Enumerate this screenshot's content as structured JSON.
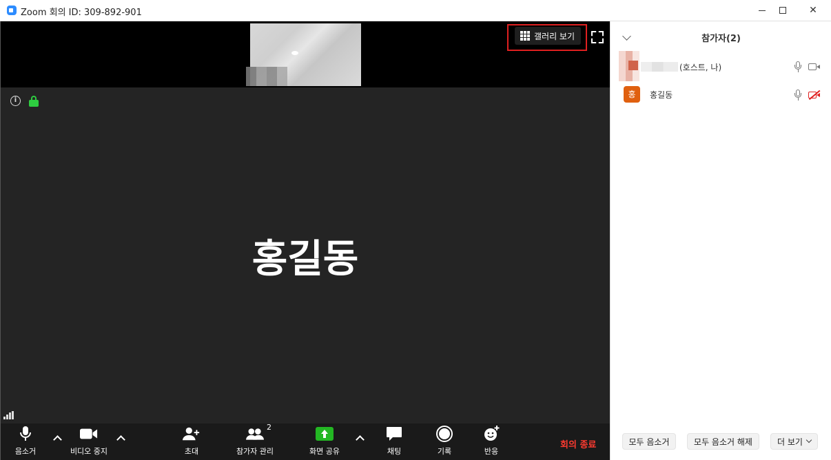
{
  "window": {
    "title": "Zoom 회의 ID: 309-892-901",
    "app_icon": "zoom-camera-icon"
  },
  "video": {
    "gallery_label": "갤러리 보기",
    "speaker_name": "홍길동"
  },
  "toolbar": {
    "mute_label": "음소거",
    "stop_video_label": "비디오 중지",
    "invite_label": "초대",
    "participants_label": "참가자 관리",
    "participants_count": "2",
    "share_label": "화면 공유",
    "chat_label": "채팅",
    "record_label": "기록",
    "reactions_label": "반응",
    "end_label": "회의 종료",
    "share_color": "#23b723",
    "end_color": "#ff3b30"
  },
  "panel": {
    "title": "참가자(2)",
    "participants": [
      {
        "name": "(호스트, 나)",
        "mic": "on",
        "video": "on"
      },
      {
        "name": "홍길동",
        "initial": "홍",
        "mic": "on",
        "video": "off"
      }
    ],
    "mute_all_label": "모두 음소거",
    "unmute_all_label": "모두 음소거 해제",
    "more_label": "더 보기"
  }
}
